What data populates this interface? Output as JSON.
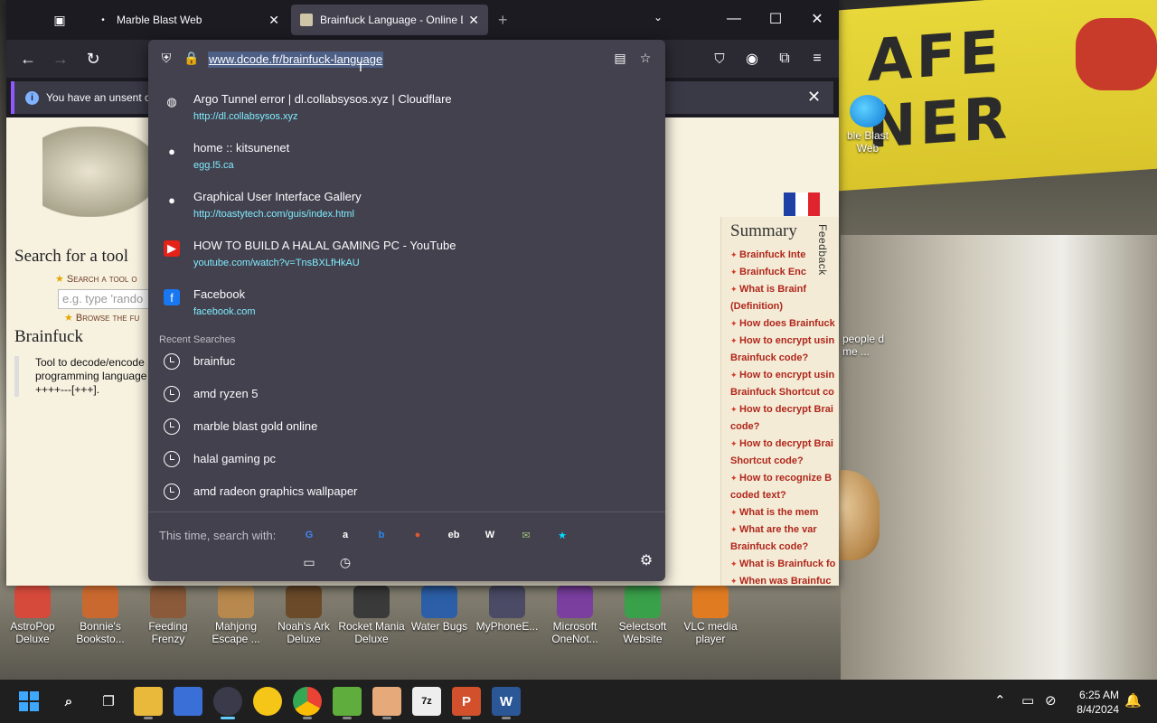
{
  "tabs": [
    {
      "title": "Marble Blast Web",
      "close": "✕"
    },
    {
      "title": "Brainfuck Language - Online De",
      "close": "✕"
    }
  ],
  "new_tab": "+",
  "address": {
    "url": "www.dcode.fr/brainfuck-language"
  },
  "notification": {
    "text": "You have an unsent cr"
  },
  "suggestions": [
    {
      "title": "Argo Tunnel error | dl.collabsysos.xyz | Cloudflare",
      "url": "http://dl.collabsysos.xyz",
      "icon": "globe-icon"
    },
    {
      "title": "home :: kitsunenet",
      "url": "egg.l5.ca",
      "icon": "site-icon"
    },
    {
      "title": "Graphical User Interface Gallery",
      "url": "http://toastytech.com/guis/index.html",
      "icon": "site-icon"
    },
    {
      "title": "HOW TO BUILD A HALAL GAMING PC - YouTube",
      "url": "youtube.com/watch?v=TnsBXLfHkAU",
      "icon": "youtube-icon"
    },
    {
      "title": "Facebook",
      "url": "facebook.com",
      "icon": "facebook-icon"
    }
  ],
  "recent_searches_label": "Recent Searches",
  "recent_searches": [
    "brainfuc",
    "amd ryzen 5",
    "marble blast gold online",
    "halal gaming pc",
    "amd radeon graphics wallpaper"
  ],
  "search_with_label": "This time, search with:",
  "engines": [
    {
      "name": "google-icon",
      "glyph": "G",
      "color": "#4285f4"
    },
    {
      "name": "amazon-icon",
      "glyph": "a",
      "color": "#ffffff"
    },
    {
      "name": "bing-icon",
      "glyph": "b",
      "color": "#2a8bf2"
    },
    {
      "name": "duckduckgo-icon",
      "glyph": "●",
      "color": "#de5833"
    },
    {
      "name": "ebay-icon",
      "glyph": "eb",
      "color": "#ffffff"
    },
    {
      "name": "wikipedia-icon",
      "glyph": "W",
      "color": "#ffffff"
    },
    {
      "name": "custom-engine-icon",
      "glyph": "✉",
      "color": "#9bbf7a"
    },
    {
      "name": "bookmark-star-icon",
      "glyph": "★",
      "color": "#00ddff"
    }
  ],
  "page": {
    "search_heading": "Search for a tool",
    "search_link": "Search a tool o",
    "search_placeholder": "e.g. type 'rando",
    "browse_link": "Browse the fu",
    "section": "Brainfuck",
    "description": "Tool to decode/encode programming language ++++---[+++].",
    "feedback": "Feedback",
    "summary_title": "Summary",
    "summary_items": [
      "Brainfuck Inte",
      "Brainfuck Enc",
      "What is Brainf (Definition)",
      "How does Brainfuck",
      "How to encrypt usin Brainfuck code?",
      "How to encrypt usin Brainfuck Shortcut co",
      "How to decrypt Brai code?",
      "How to decrypt Brai Shortcut code?",
      "How to recognize B coded text?",
      "What is the mem",
      "What are the var Brainfuck code?",
      "What is Brainfuck fo",
      "When was Brainfuc"
    ]
  },
  "desktop_icons": [
    "AstroPop Deluxe",
    "Bonnie's Booksto...",
    "Feeding Frenzy",
    "Mahjong Escape ...",
    "Noah's Ark Deluxe",
    "Rocket Mania Deluxe",
    "Water Bugs",
    "MyPhoneE...",
    "Microsoft OneNot...",
    "Selectsoft Website",
    "VLC media player"
  ],
  "desktop_right": {
    "icon_label": "ble Blast Web",
    "snippet": "people d me ..."
  },
  "clock": {
    "time": "6:25 AM",
    "date": "8/4/2024"
  },
  "sign_text": "AFE NER"
}
